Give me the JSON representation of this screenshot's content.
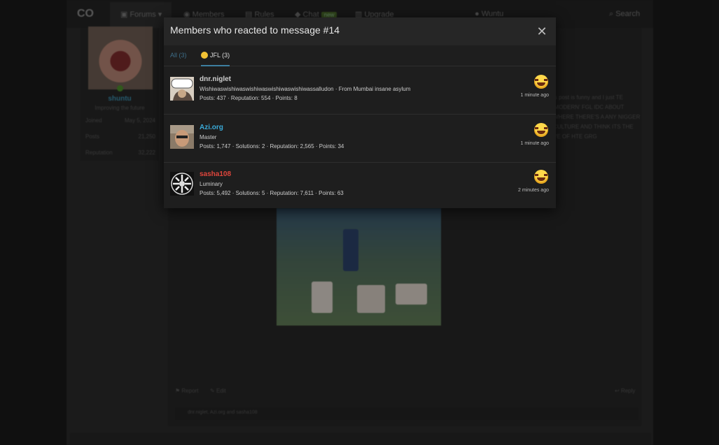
{
  "nav": {
    "logo": "CO",
    "items": [
      "Forums",
      "Members",
      "Rules",
      "Chat",
      "Upgrade"
    ],
    "chat_badge": "new",
    "user": "Wuntu",
    "search": "Search"
  },
  "sidebar": {
    "username": "shuntu",
    "usertitle": "Improving the future",
    "stats": [
      {
        "label": "Joined",
        "value": "May 5, 2024"
      },
      {
        "label": "Posts",
        "value": "21,250"
      },
      {
        "label": "Reputation",
        "value": "32,222"
      }
    ]
  },
  "post": {
    "text": "is post is funny and I just TE 'MODERN' FGL IDC ABOUT WHERE THERE'S A ANY NIGGER CULTURE AND THINK ITS THE VE OF HTE GRG",
    "actions": {
      "report": "Report",
      "edit": "Edit",
      "reply": "Reply"
    },
    "reacted_by": "dnr.niglet, Azi.org and sasha108"
  },
  "modal": {
    "title": "Members who reacted to message #14",
    "tabs": {
      "all": "All (3)",
      "jfl": "JFL (3)"
    },
    "members": [
      {
        "name": "dnr.niglet",
        "name_color": "#cfcfcf",
        "title": "Wishiwaswishiwaswishiwaswishiwaswishiwassalludon · From Mumbai insane asylum",
        "stats": "Posts: 437 · Reputation: 554 · Points: 8",
        "time": "1 minute ago"
      },
      {
        "name": "Azi.org",
        "name_color": "#3aaad8",
        "title": "Master",
        "stats": "Posts: 1,747 · Solutions: 2 · Reputation: 2,565 · Points: 34",
        "time": "1 minute ago"
      },
      {
        "name": "sasha108",
        "name_color": "#e0463c",
        "title": "Luminary",
        "stats": "Posts: 5,492 · Solutions: 5 · Reputation: 7,611 · Points: 63",
        "time": "2 minutes ago"
      }
    ]
  }
}
